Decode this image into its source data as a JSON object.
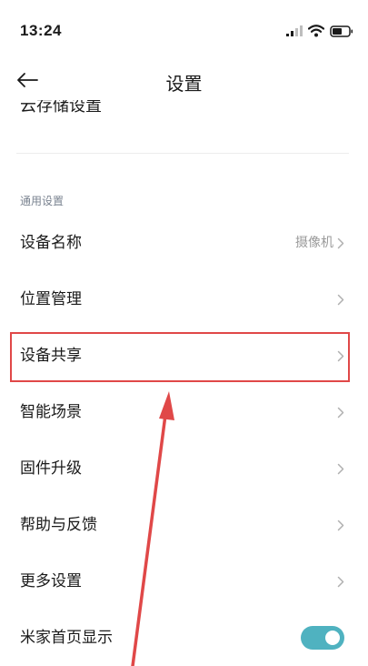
{
  "status_bar": {
    "time": "13:24",
    "icons": [
      "signal-icon",
      "wifi-icon",
      "battery-icon"
    ]
  },
  "header": {
    "title": "设置",
    "back_icon": "back-arrow-icon"
  },
  "clipped_row": {
    "label": "云存储设置"
  },
  "section": {
    "label": "通用设置"
  },
  "rows": [
    {
      "label": "设备名称",
      "value": "摄像机"
    },
    {
      "label": "位置管理"
    },
    {
      "label": "设备共享"
    },
    {
      "label": "智能场景"
    },
    {
      "label": "固件升级"
    },
    {
      "label": "帮助与反馈"
    },
    {
      "label": "更多设置"
    },
    {
      "label": "米家首页显示",
      "toggle": true
    }
  ],
  "annotation": {
    "highlight_color": "#e04848",
    "highlighted_row": "设备共享"
  },
  "colors": {
    "toggle_on": "#4fb2c0",
    "section_label": "#7a8390"
  }
}
